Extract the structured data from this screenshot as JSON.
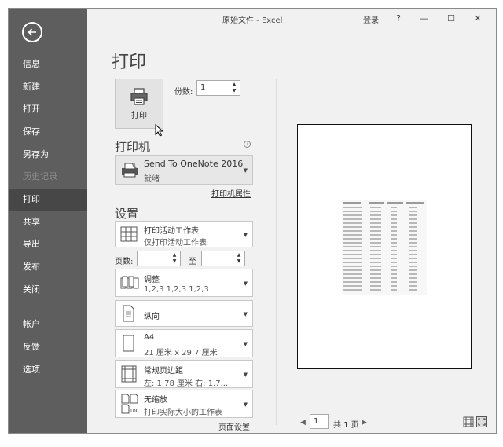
{
  "window": {
    "title": "原始文件 - Excel",
    "login": "登录",
    "help": "?",
    "minimize": "—",
    "maximize": "☐",
    "close": "✕"
  },
  "sidebar": {
    "items": [
      {
        "label": "信息"
      },
      {
        "label": "新建"
      },
      {
        "label": "打开"
      },
      {
        "label": "保存"
      },
      {
        "label": "另存为"
      },
      {
        "label": "历史记录"
      },
      {
        "label": "打印"
      },
      {
        "label": "共享"
      },
      {
        "label": "导出"
      },
      {
        "label": "发布"
      },
      {
        "label": "关闭"
      },
      {
        "label": "帐户"
      },
      {
        "label": "反馈"
      },
      {
        "label": "选项"
      }
    ]
  },
  "main": {
    "page_title": "打印",
    "print_button": "打印",
    "copies_label": "份数:",
    "copies_value": "1",
    "printer_section": "打印机",
    "printer_name": "Send To OneNote 2016",
    "printer_status": "就绪",
    "printer_properties": "打印机属性",
    "settings_section": "设置",
    "settings": [
      {
        "line1": "打印活动工作表",
        "line2": "仅打印活动工作表"
      },
      {
        "line1": "调整",
        "line2": "1,2,3    1,2,3    1,2,3"
      },
      {
        "line1": "纵向",
        "line2": ""
      },
      {
        "line1": "A4",
        "line2": "21 厘米 x 29.7 厘米"
      },
      {
        "line1": "常规页边距",
        "line2": "左: 1.78 厘米    右: 1.7..."
      },
      {
        "line1": "无缩放",
        "line2": "打印实际大小的工作表"
      }
    ],
    "pages_label": "页数:",
    "to_label": "至",
    "page_setup": "页面设置"
  },
  "preview": {
    "current_page": "1",
    "total_pages": "共 1 页"
  },
  "colors": {
    "sidebar": "#5e5e5e",
    "sidebar_active": "#474747",
    "background": "#f1f1f1"
  }
}
